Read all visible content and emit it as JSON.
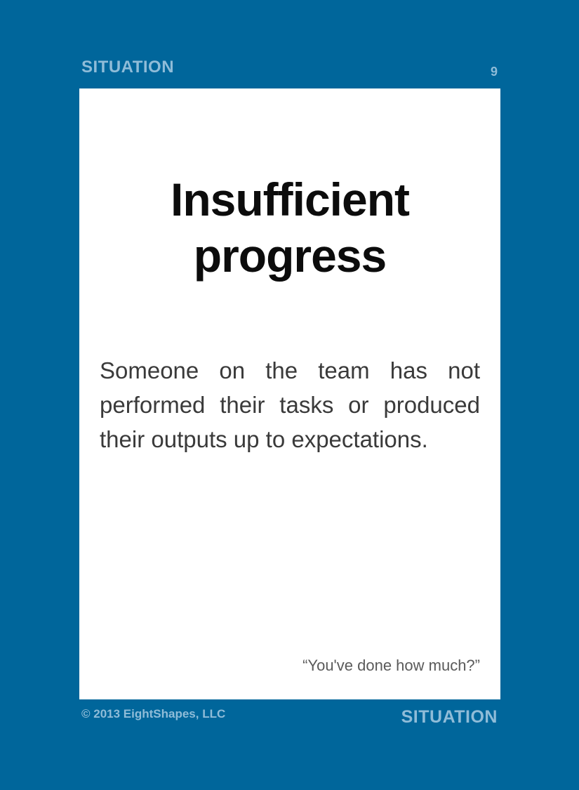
{
  "header": {
    "category": "SITUATION",
    "card_number": "9"
  },
  "card": {
    "title": "Insufficient progress",
    "description": "Someone on the team has not performed their tasks or produced their outputs up to expectations.",
    "quote": "“You've done how much?”"
  },
  "footer": {
    "copyright": "© 2013 EightShapes, LLC",
    "category": "SITUATION"
  },
  "colors": {
    "background": "#00669b",
    "label": "#8fbcd8",
    "card": "#ffffff",
    "title": "#0c0c0c",
    "body_text": "#3a3a3a",
    "quote_text": "#5a5a5a"
  }
}
